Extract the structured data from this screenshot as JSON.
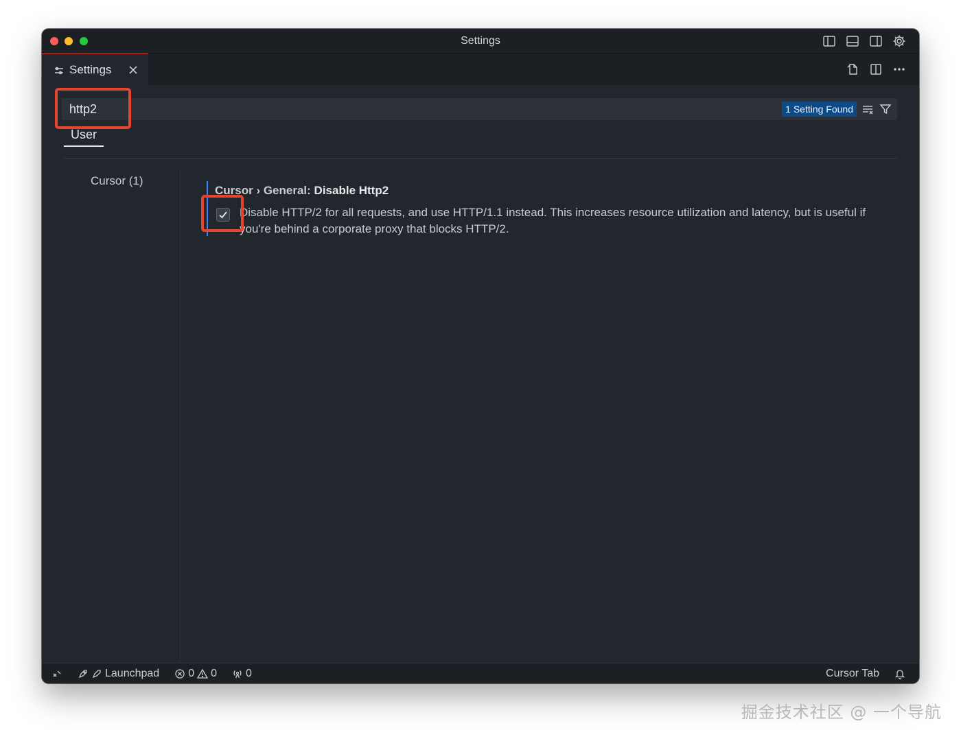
{
  "window": {
    "title": "Settings"
  },
  "tab": {
    "label": "Settings"
  },
  "search": {
    "value": "http2",
    "placeholder": "",
    "found_label": "1 Setting Found"
  },
  "scope": {
    "active_tab": "User"
  },
  "toc": {
    "items": [
      {
        "label": "Cursor (1)"
      }
    ]
  },
  "setting": {
    "category": "Cursor › General: ",
    "name": "Disable Http2",
    "checked": true,
    "description": "Disable HTTP/2 for all requests, and use HTTP/1.1 instead. This increases resource utilization and latency, but is useful if you're behind a corporate proxy that blocks HTTP/2."
  },
  "statusbar": {
    "launchpad_label": "Launchpad",
    "errors": "0",
    "warnings": "0",
    "ports": "0",
    "right_label": "Cursor Tab"
  },
  "watermark": "掘金技术社区 @ 一个导航",
  "colors": {
    "accent": "#3b82f6",
    "highlight": "#e8432b",
    "badge": "#0e4a86"
  }
}
